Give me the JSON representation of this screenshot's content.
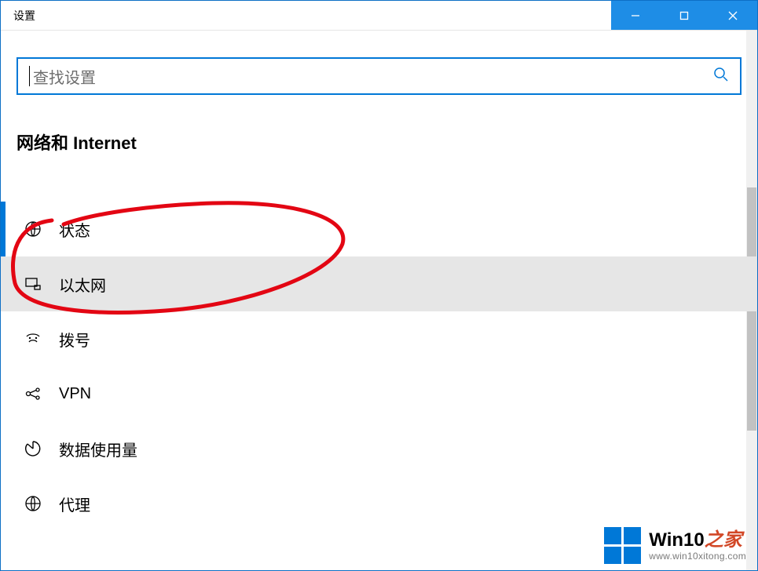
{
  "titlebar": {
    "title": "设置"
  },
  "search": {
    "placeholder": "查找设置"
  },
  "heading": "网络和 Internet",
  "nav": {
    "items": [
      {
        "label": "状态",
        "icon": "status"
      },
      {
        "label": "以太网",
        "icon": "ethernet"
      },
      {
        "label": "拨号",
        "icon": "dialup"
      },
      {
        "label": "VPN",
        "icon": "vpn"
      },
      {
        "label": "数据使用量",
        "icon": "data"
      },
      {
        "label": "代理",
        "icon": "proxy"
      }
    ]
  },
  "watermark": {
    "brand_prefix": "Win10",
    "brand_suffix": "之家",
    "url": "www.win10xitong.com"
  }
}
